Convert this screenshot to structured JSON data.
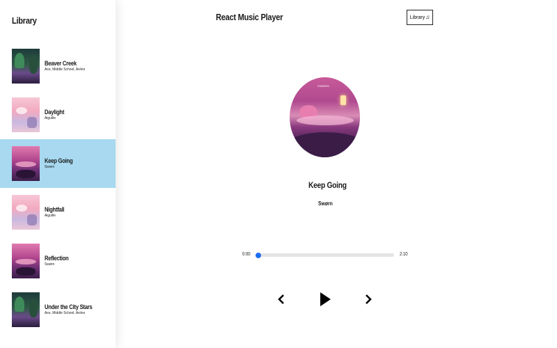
{
  "library": {
    "title": "Library",
    "songs": [
      {
        "name": "Beaver Creek",
        "artist": "Aso, Middle School, Aviino",
        "cover": "green",
        "active": false
      },
      {
        "name": "Daylight",
        "artist": "Aiguille",
        "cover": "pink",
        "active": false
      },
      {
        "name": "Keep Going",
        "artist": "Swørn",
        "cover": "purple",
        "active": true
      },
      {
        "name": "Nightfall",
        "artist": "Aiguille",
        "cover": "pink",
        "active": false
      },
      {
        "name": "Reflection",
        "artist": "Swørn",
        "cover": "purple",
        "active": false
      },
      {
        "name": "Under the City Stars",
        "artist": "Aso, Middle School, Aviino",
        "cover": "green",
        "active": false
      }
    ]
  },
  "header": {
    "title": "React Music Player",
    "library_button_label": "Library",
    "library_button_icon": "music-note-icon"
  },
  "now_playing": {
    "title": "Keep Going",
    "artist": "Swørn",
    "cover_label": "SWØRN"
  },
  "player": {
    "current_time": "0:00",
    "duration": "2:10",
    "progress": 0.0
  },
  "colors": {
    "active_row": "#a8d9f0",
    "seek_thumb": "#1e6ff0"
  }
}
